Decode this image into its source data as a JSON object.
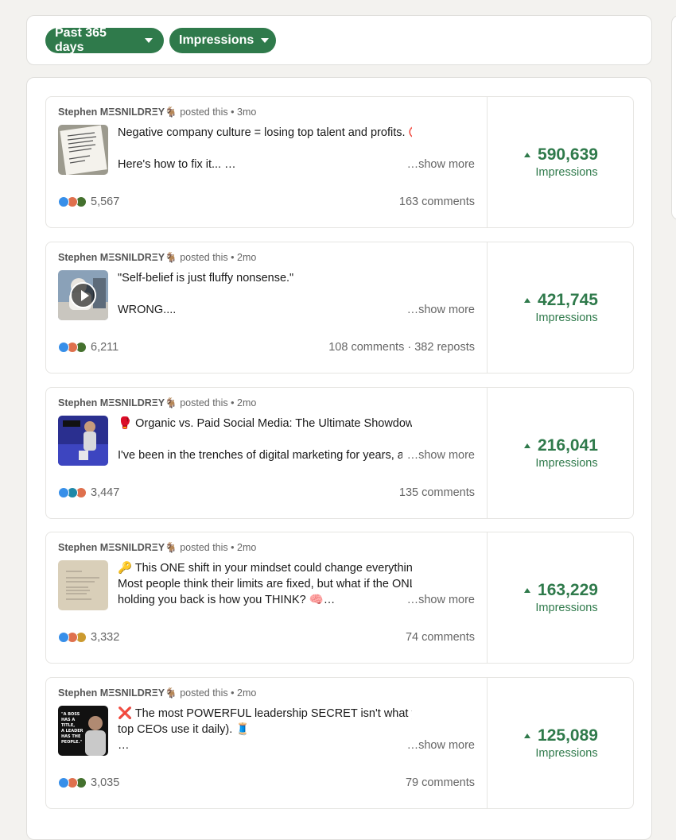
{
  "filters": {
    "date_range": "Past 365 days",
    "metric": "Impressions"
  },
  "colors": {
    "accent": "#2f7a4b",
    "muted_text": "#666666",
    "card_border": "#e0dfdc"
  },
  "posts": [
    {
      "author": "Stephen MΞSNILDRΞY🐐",
      "posted": "posted this",
      "sep": "•",
      "age": "3mo",
      "thumb": "text-card",
      "lines": [
        "Negative company culture = losing top talent and profits. 🚫💸",
        "",
        "Here's how to fix it... …"
      ],
      "show_more": "…show more",
      "reactions": [
        "like",
        "love",
        "celebrate"
      ],
      "reaction_count": "5,567",
      "engagement": "163 comments",
      "impressions": "590,639",
      "impressions_label": "Impressions"
    },
    {
      "author": "Stephen MΞSNILDRΞY🐐",
      "posted": "posted this",
      "sep": "•",
      "age": "2mo",
      "thumb": "video",
      "lines": [
        "\"Self-belief is just fluffy nonsense.\"",
        "",
        "WRONG...."
      ],
      "show_more": "…show more",
      "reactions": [
        "like",
        "love",
        "celebrate"
      ],
      "reaction_count": "6,211",
      "engagement": "108 comments · 382 reposts",
      "impressions": "421,745",
      "impressions_label": "Impressions"
    },
    {
      "author": "Stephen MΞSNILDRΞY🐐",
      "posted": "posted this",
      "sep": "•",
      "age": "2mo",
      "thumb": "photo-blue",
      "lines": [
        "🥊 Organic vs. Paid Social Media: The Ultimate Showdown 🥊",
        "",
        "I've been in the trenches of digital marketing for years, ar"
      ],
      "show_more": "…show more",
      "reactions": [
        "like",
        "funny",
        "love"
      ],
      "reaction_count": "3,447",
      "engagement": "135 comments",
      "impressions": "216,041",
      "impressions_label": "Impressions"
    },
    {
      "author": "Stephen MΞSNILDRΞY🐐",
      "posted": "posted this",
      "sep": "•",
      "age": "2mo",
      "thumb": "paper-note",
      "lines": [
        "🔑 This ONE shift in your mindset could change everything.",
        "Most people think their limits are fixed, but what if the ONLY thing",
        "holding you back is how you THINK? 🧠…"
      ],
      "show_more": "…show more",
      "reactions": [
        "like",
        "love",
        "support"
      ],
      "reaction_count": "3,332",
      "engagement": "74 comments",
      "impressions": "163,229",
      "impressions_label": "Impressions"
    },
    {
      "author": "Stephen MΞSNILDRΞY🐐",
      "posted": "posted this",
      "sep": "•",
      "age": "2mo",
      "thumb": "quote-portrait",
      "thumb_text": "\"A BOSS HAS A TITLE, A LEADER HAS THE PEOPLE.\"",
      "lines": [
        "❌ The most POWERFUL leadership SECRET isn't what you think (and",
        "top CEOs use it daily). 🧵",
        "…"
      ],
      "show_more": "…show more",
      "reactions": [
        "like",
        "love",
        "celebrate"
      ],
      "reaction_count": "3,035",
      "engagement": "79 comments",
      "impressions": "125,089",
      "impressions_label": "Impressions"
    }
  ]
}
